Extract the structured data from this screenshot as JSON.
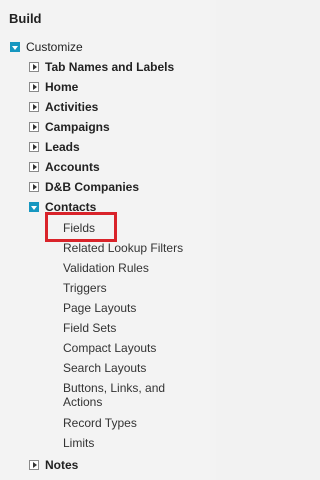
{
  "section_title": "Build",
  "root": {
    "label": "Customize"
  },
  "items": [
    {
      "label": "Tab Names and Labels"
    },
    {
      "label": "Home"
    },
    {
      "label": "Activities"
    },
    {
      "label": "Campaigns"
    },
    {
      "label": "Leads"
    },
    {
      "label": "Accounts"
    },
    {
      "label": "D&B Companies"
    },
    {
      "label": "Contacts"
    },
    {
      "label": "Notes"
    }
  ],
  "contacts_children": [
    {
      "label": "Fields"
    },
    {
      "label": "Related Lookup Filters"
    },
    {
      "label": "Validation Rules"
    },
    {
      "label": "Triggers"
    },
    {
      "label": "Page Layouts"
    },
    {
      "label": "Field Sets"
    },
    {
      "label": "Compact Layouts"
    },
    {
      "label": "Search Layouts"
    },
    {
      "label": "Buttons, Links, and Actions"
    },
    {
      "label": "Record Types"
    },
    {
      "label": "Limits"
    }
  ],
  "colors": {
    "expanded_toggle": "#1797c0",
    "highlight": "#d9232a"
  }
}
